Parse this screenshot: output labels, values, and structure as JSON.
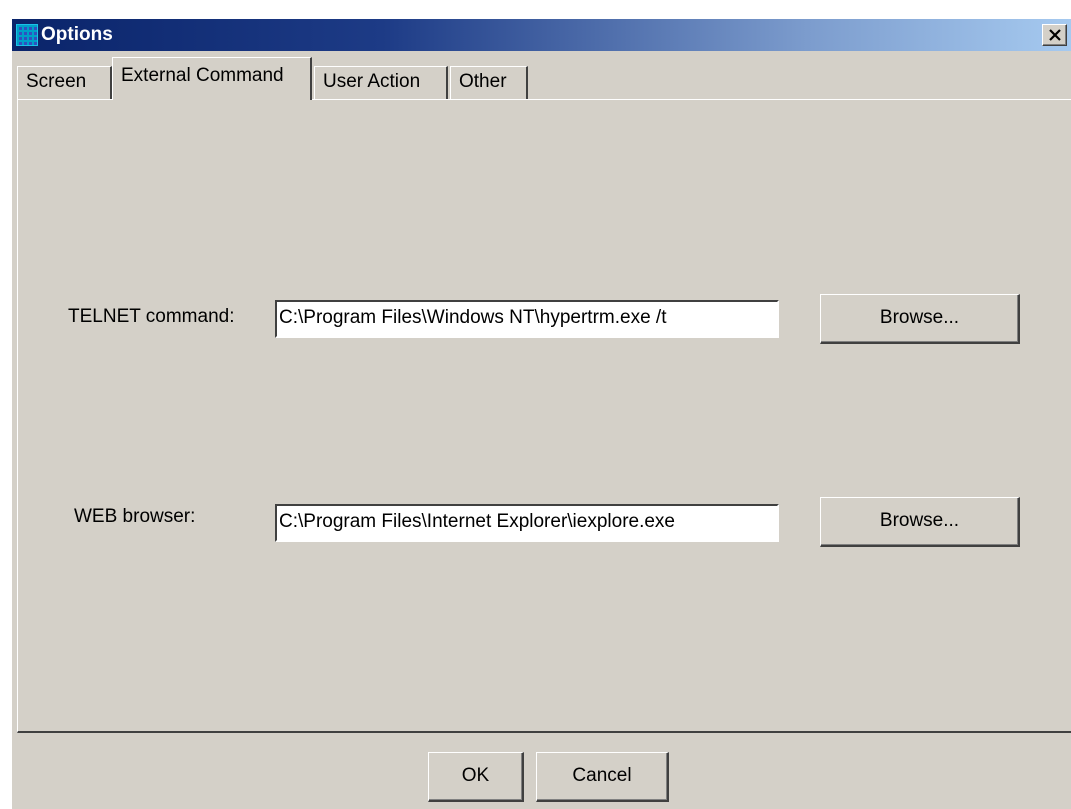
{
  "window": {
    "title": "Options",
    "close_label": "X"
  },
  "tabs": [
    {
      "label": "Screen",
      "active": false
    },
    {
      "label": "External Command",
      "active": true
    },
    {
      "label": "User Action",
      "active": false
    },
    {
      "label": "Other",
      "active": false
    }
  ],
  "external_command": {
    "telnet": {
      "label": "TELNET command:",
      "value": "C:\\Program Files\\Windows NT\\hypertrm.exe /t",
      "browse_label": "Browse..."
    },
    "web": {
      "label": "WEB browser:",
      "value": "C:\\Program Files\\Internet Explorer\\iexplore.exe",
      "browse_label": "Browse..."
    }
  },
  "footer": {
    "ok_label": "OK",
    "cancel_label": "Cancel"
  },
  "colors": {
    "dialog_face": "#d4d0c8",
    "titlebar_start": "#0a246a",
    "titlebar_end": "#a6caf0"
  },
  "icons": {
    "app": "grid-app-icon",
    "close": "close-icon"
  }
}
